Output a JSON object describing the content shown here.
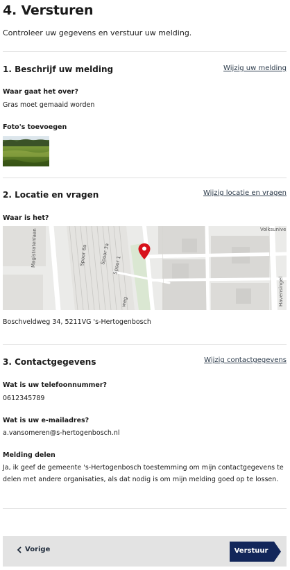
{
  "page": {
    "title": "4. Versturen",
    "intro": "Controleer uw gegevens en verstuur uw melding."
  },
  "section1": {
    "title": "1. Beschrijf uw melding",
    "edit_link": "Wijzig uw melding",
    "question_label": "Waar gaat het over?",
    "question_value": "Gras moet gemaaid worden",
    "photos_label": "Foto's toevoegen"
  },
  "section2": {
    "title": "2. Locatie en vragen",
    "edit_link": "Wijzig locatie en vragen",
    "where_label": "Waar is het?",
    "address": "Boschveldweg 34, 5211VG 's-Hertogenbosch",
    "map_labels": {
      "volksun": "Volksunive",
      "magistraat": "Magistratenlaan",
      "spoor6a": "Spoor 6a",
      "spoor3a": "Spoor 3a",
      "spoor1": "Spoor 1",
      "weg": "weg",
      "havens": "Havensingel"
    }
  },
  "section3": {
    "title": "3. Contactgegevens",
    "edit_link": "Wijzig contactgegevens",
    "phone_label": "Wat is uw telefoonnummer?",
    "phone_value": "0612345789",
    "email_label": "Wat is uw e-mailadres?",
    "email_value": "a.vansomeren@s-hertogenbosch.nl",
    "share_label": "Melding delen",
    "share_value": "Ja, ik geef de gemeente 's-Hertogenbosch toestemming om mijn contactgegevens te delen met andere organisaties, als dat nodig is om mijn melding goed op te lossen."
  },
  "footer": {
    "prev_label": "Vorige",
    "submit_label": "Verstuur"
  },
  "colors": {
    "submit_bg": "#12265a",
    "footer_bg": "#e3e3e3",
    "pin": "#d8121b"
  },
  "icons": {
    "prev": "chevron-left-icon",
    "pin": "map-pin-icon"
  }
}
